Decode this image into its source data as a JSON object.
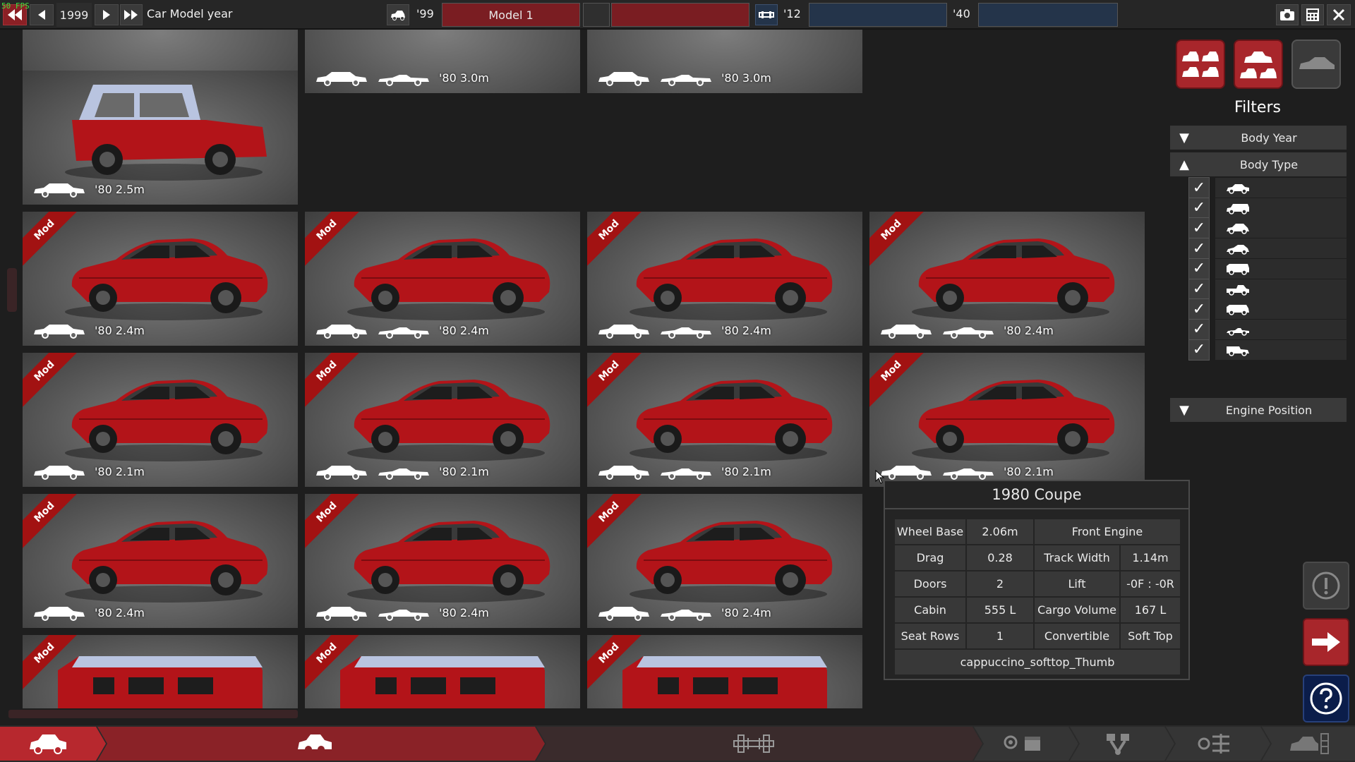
{
  "fps": "50 FPS",
  "topbar": {
    "year": "1999",
    "title": "Car Model year",
    "body_year": "'99",
    "model_name": "Model 1",
    "trim_start_year": "'12",
    "trim_end_year": "'40"
  },
  "colors": {
    "accent_red": "#a8262b",
    "dark_red": "#7a1d22",
    "blue_field": "#24344a",
    "panel": "#3a3a3a"
  },
  "tiles": [
    {
      "label": "'80 3.0m",
      "mod": false,
      "body": "truck-wheel"
    },
    {
      "label": "'80 3.0m",
      "mod": false,
      "body": "truck-wheel"
    },
    {
      "label": "'80 3.0m",
      "mod": false,
      "body": "truck-wheel"
    },
    {
      "label": "'80 2.5m",
      "mod": false,
      "body": "jeep"
    },
    {
      "label": "'80 2.4m",
      "mod": true,
      "mod_text": "Mod",
      "body": "coupe"
    },
    {
      "label": "'80 2.4m",
      "mod": true,
      "mod_text": "Mod",
      "body": "coupe"
    },
    {
      "label": "'80 2.4m",
      "mod": true,
      "mod_text": "Mod",
      "body": "coupe"
    },
    {
      "label": "'80 2.4m",
      "mod": true,
      "mod_text": "Mod",
      "body": "coupe"
    },
    {
      "label": "'80 2.1m",
      "mod": true,
      "mod_text": "Mod",
      "body": "coupe"
    },
    {
      "label": "'80 2.1m",
      "mod": true,
      "mod_text": "Mod",
      "body": "coupe"
    },
    {
      "label": "'80 2.1m",
      "mod": true,
      "mod_text": "Mod",
      "body": "coupe"
    },
    {
      "label": "'80 2.1m",
      "mod": true,
      "mod_text": "Mod",
      "body": "coupe"
    },
    {
      "label": "'80 2.4m",
      "mod": true,
      "mod_text": "Mod",
      "body": "coupe"
    },
    {
      "label": "'80 2.4m",
      "mod": true,
      "mod_text": "Mod",
      "body": "coupe"
    },
    {
      "label": "'80 2.4m",
      "mod": true,
      "mod_text": "Mod",
      "body": "coupe"
    },
    {
      "label": "",
      "mod": true,
      "mod_text": "Mod",
      "body": "van"
    },
    {
      "label": "",
      "mod": true,
      "mod_text": "Mod",
      "body": "van"
    },
    {
      "label": "",
      "mod": true,
      "mod_text": "Mod",
      "body": "van"
    }
  ],
  "filters": {
    "title": "Filters",
    "sections": {
      "body_year": "Body Year",
      "body_type": "Body Type",
      "engine_position": "Engine Position"
    },
    "body_type_options": [
      {
        "icon": "sedan-icon",
        "checked": true
      },
      {
        "icon": "wagon-icon",
        "checked": true
      },
      {
        "icon": "hatchback-icon",
        "checked": true
      },
      {
        "icon": "coupe-icon",
        "checked": true
      },
      {
        "icon": "van-icon",
        "checked": true
      },
      {
        "icon": "pickup-icon",
        "checked": true
      },
      {
        "icon": "suv-icon",
        "checked": true
      },
      {
        "icon": "roadster-icon",
        "checked": true
      },
      {
        "icon": "utility-icon",
        "checked": true
      }
    ]
  },
  "tooltip": {
    "title": "1980 Coupe",
    "wheel_base_label": "Wheel Base",
    "wheel_base": "2.06m",
    "engine": "Front Engine",
    "drag_label": "Drag",
    "drag": "0.28",
    "track_width_label": "Track Width",
    "track_width": "1.14m",
    "doors_label": "Doors",
    "doors": "2",
    "lift_label": "Lift",
    "lift": "-0F : -0R",
    "cabin_label": "Cabin",
    "cabin": "555 L",
    "cargo_label": "Cargo Volume",
    "cargo": "167 L",
    "seat_rows_label": "Seat Rows",
    "seat_rows": "1",
    "convertible_label": "Convertible",
    "convertible": "Soft Top",
    "thumb": "cappuccino_softtop_Thumb"
  }
}
